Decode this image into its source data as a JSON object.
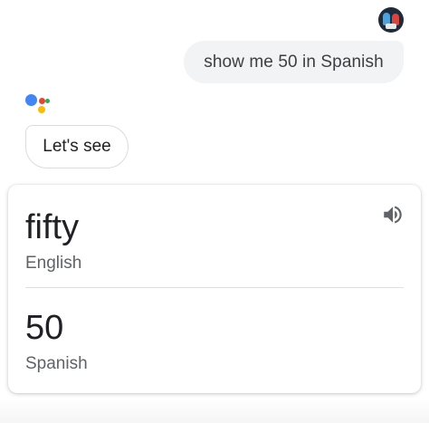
{
  "user_query": "show me 50 in Spanish",
  "assistant_reply": "Let's see",
  "translation_card": {
    "source_text": "fifty",
    "source_language": "English",
    "target_text": "50",
    "target_language": "Spanish",
    "speaker_icon": "volume-speaker-icon"
  },
  "assistant_logo_colors": {
    "blue": "#4285f4",
    "red": "#ea4335",
    "yellow": "#fbbc05",
    "green": "#34a853"
  },
  "user_avatar_icon": "user-avatar-icon"
}
